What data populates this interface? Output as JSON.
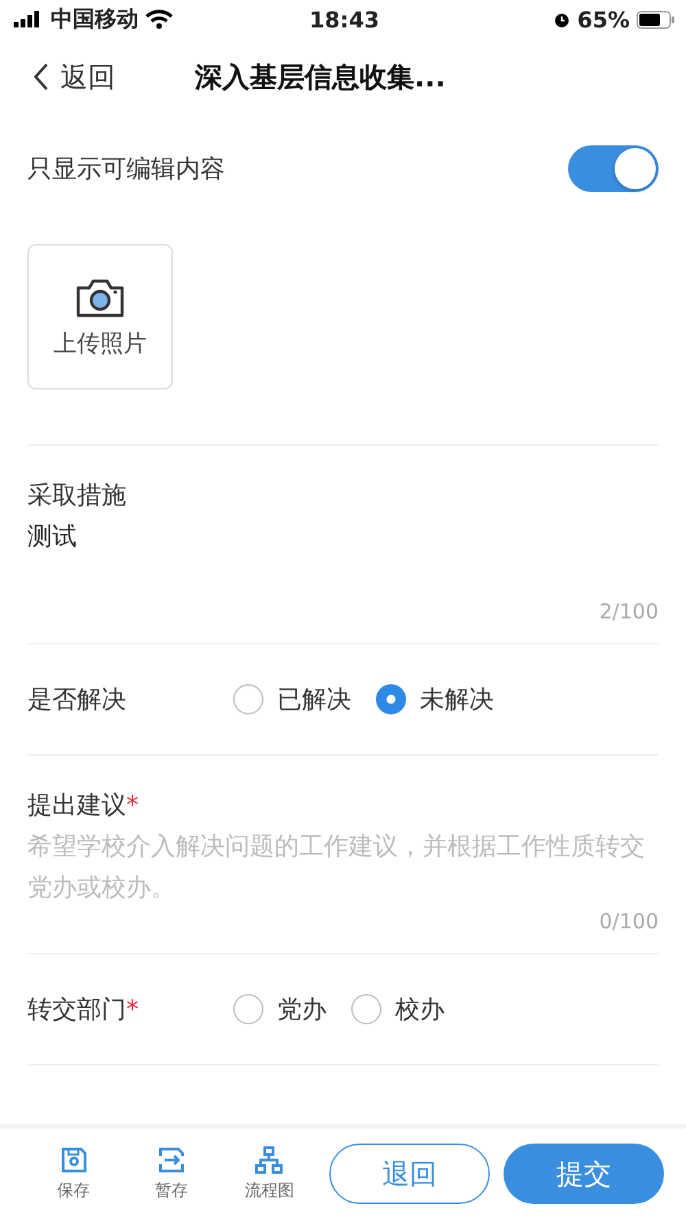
{
  "status_bar": {
    "carrier": "中国移动",
    "time": "18:43",
    "battery": "65%"
  },
  "nav": {
    "back": "返回",
    "title": "深入基层信息收集..."
  },
  "toggle": {
    "label": "只显示可编辑内容",
    "on": true
  },
  "upload": {
    "label": "上传照片"
  },
  "measure": {
    "label": "采取措施",
    "value": "测试",
    "counter": "2/100"
  },
  "resolved": {
    "label": "是否解决",
    "options": [
      {
        "label": "已解决",
        "selected": false
      },
      {
        "label": "未解决",
        "selected": true
      }
    ]
  },
  "suggestion": {
    "label": "提出建议",
    "required_mark": "*",
    "placeholder": "希望学校介入解决问题的工作建议，并根据工作性质转交党办或校办。",
    "counter": "0/100"
  },
  "department": {
    "label": "转交部门",
    "required_mark": "*",
    "options": [
      {
        "label": "党办",
        "selected": false
      },
      {
        "label": "校办",
        "selected": false
      }
    ]
  },
  "footer": {
    "actions": [
      {
        "kind": "save",
        "label": "保存"
      },
      {
        "kind": "draft",
        "label": "暂存"
      },
      {
        "kind": "flow",
        "label": "流程图"
      }
    ],
    "return_button": "退回",
    "submit_button": "提交"
  }
}
